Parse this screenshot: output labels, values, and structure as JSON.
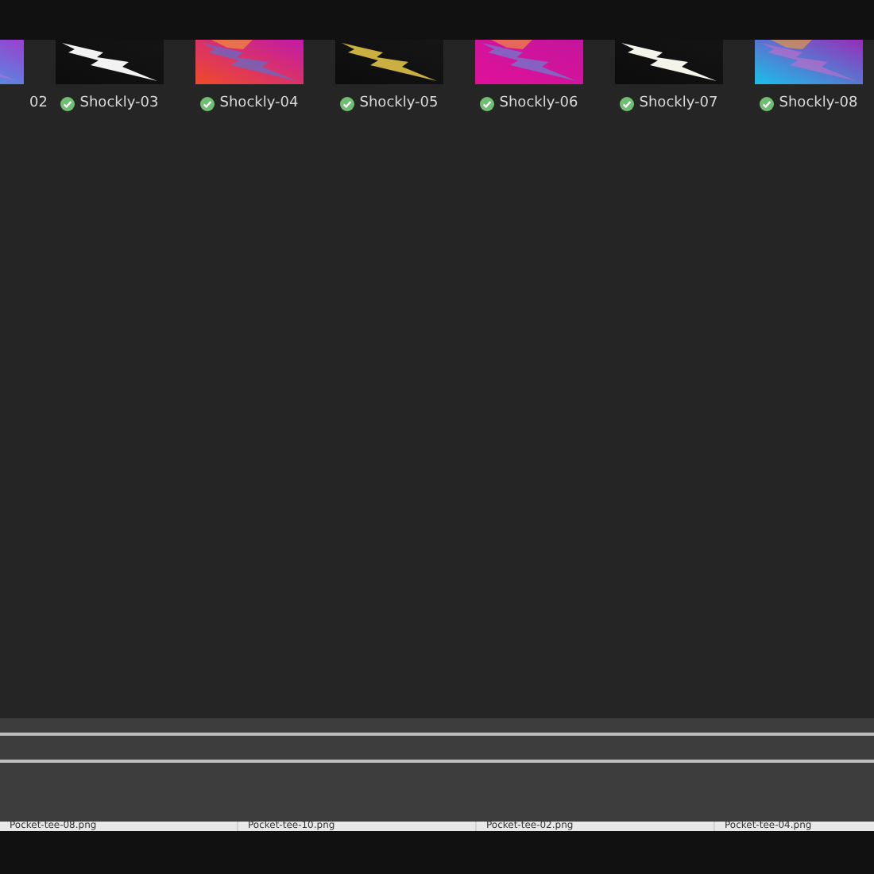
{
  "thumbnails": [
    {
      "label": "02"
    },
    {
      "label": "Shockly-03"
    },
    {
      "label": "Shockly-04"
    },
    {
      "label": "Shockly-05"
    },
    {
      "label": "Shockly-06"
    },
    {
      "label": "Shockly-07"
    },
    {
      "label": "Shockly-08"
    }
  ],
  "file_strip": [
    "Pocket-tee-08.png",
    "Pocket-tee-10.png",
    "Pocket-tee-02.png",
    "Pocket-tee-04.png"
  ]
}
